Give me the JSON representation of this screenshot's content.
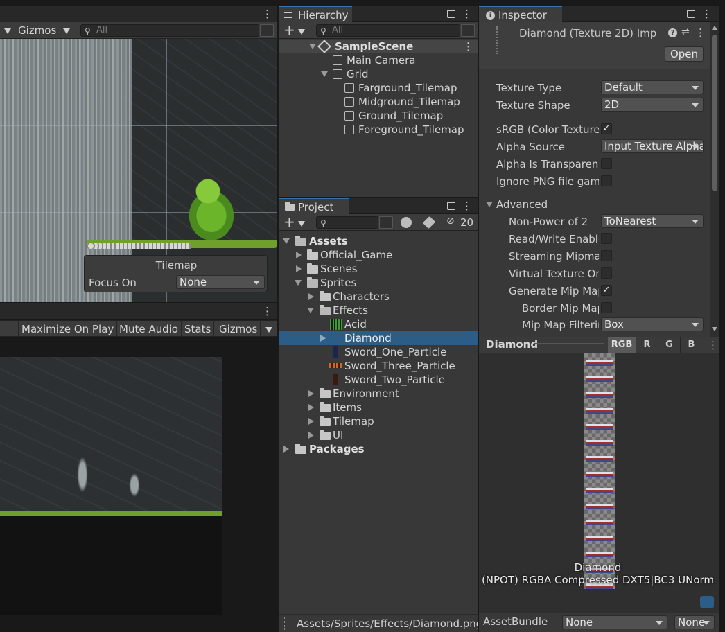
{
  "scene_toolbar": {
    "gizmos_label": "Gizmos",
    "search_placeholder": "All"
  },
  "tilemap_overlay": {
    "title": "Tilemap",
    "focus_label": "Focus On",
    "focus_value": "None"
  },
  "game_toolbar": {
    "maximize": "Maximize On Play",
    "mute": "Mute Audio",
    "stats": "Stats",
    "gizmos": "Gizmos"
  },
  "hierarchy": {
    "tab": "Hierarchy",
    "search_placeholder": "All",
    "scene": "SampleScene",
    "items": [
      "Main Camera",
      "Grid",
      "Farground_Tilemap",
      "Midground_Tilemap",
      "Ground_Tilemap",
      "Foreground_Tilemap"
    ]
  },
  "project": {
    "tab": "Project",
    "hidden_count": "20",
    "tree": [
      "Assets",
      "Official_Game",
      "Scenes",
      "Sprites",
      "Characters",
      "Effects",
      "Acid",
      "Diamond",
      "Sword_One_Particle",
      "Sword_Three_Particle",
      "Sword_Two_Particle",
      "Environment",
      "Items",
      "Tilemap",
      "UI",
      "Packages"
    ],
    "path": "Assets/Sprites/Effects/Diamond.png"
  },
  "inspector": {
    "tab": "Inspector",
    "title": "Diamond (Texture 2D) Imp",
    "open_button": "Open",
    "fields": [
      {
        "label": "Texture Type",
        "value": "Default"
      },
      {
        "label": "Texture Shape",
        "value": "2D"
      },
      {
        "label": "sRGB (Color Texture)",
        "check": "✓"
      },
      {
        "label": "Alpha Source",
        "value": "Input Texture Alpha"
      },
      {
        "label": "Alpha Is Transparency",
        "check": ""
      },
      {
        "label": "Ignore PNG file gamma",
        "check": ""
      }
    ],
    "advanced": {
      "label": "Advanced",
      "fields": [
        {
          "label": "Non-Power of 2",
          "value": "ToNearest"
        },
        {
          "label": "Read/Write Enabled",
          "check": ""
        },
        {
          "label": "Streaming Mipmaps",
          "check": ""
        },
        {
          "label": "Virtual Texture Only",
          "check": ""
        },
        {
          "label": "Generate Mip Maps",
          "check": "✓"
        },
        {
          "label": "Border Mip Maps",
          "check": ""
        },
        {
          "label": "Mip Map Filtering",
          "value": "Box"
        }
      ]
    }
  },
  "preview": {
    "title": "Diamond",
    "channels": [
      "RGB",
      "R",
      "G",
      "B"
    ],
    "name": "Diamond",
    "info": "(NPOT)  RGBA Compressed DXT5|BC3 UNorm",
    "assetbundle_label": "AssetBundle",
    "assetbundle_value": "None",
    "variant_value": "None"
  },
  "colors": {
    "selection": "#2c5d87",
    "accent_tab": "#3a72b0",
    "panel": "#383838",
    "grass": "#6fa02b"
  }
}
